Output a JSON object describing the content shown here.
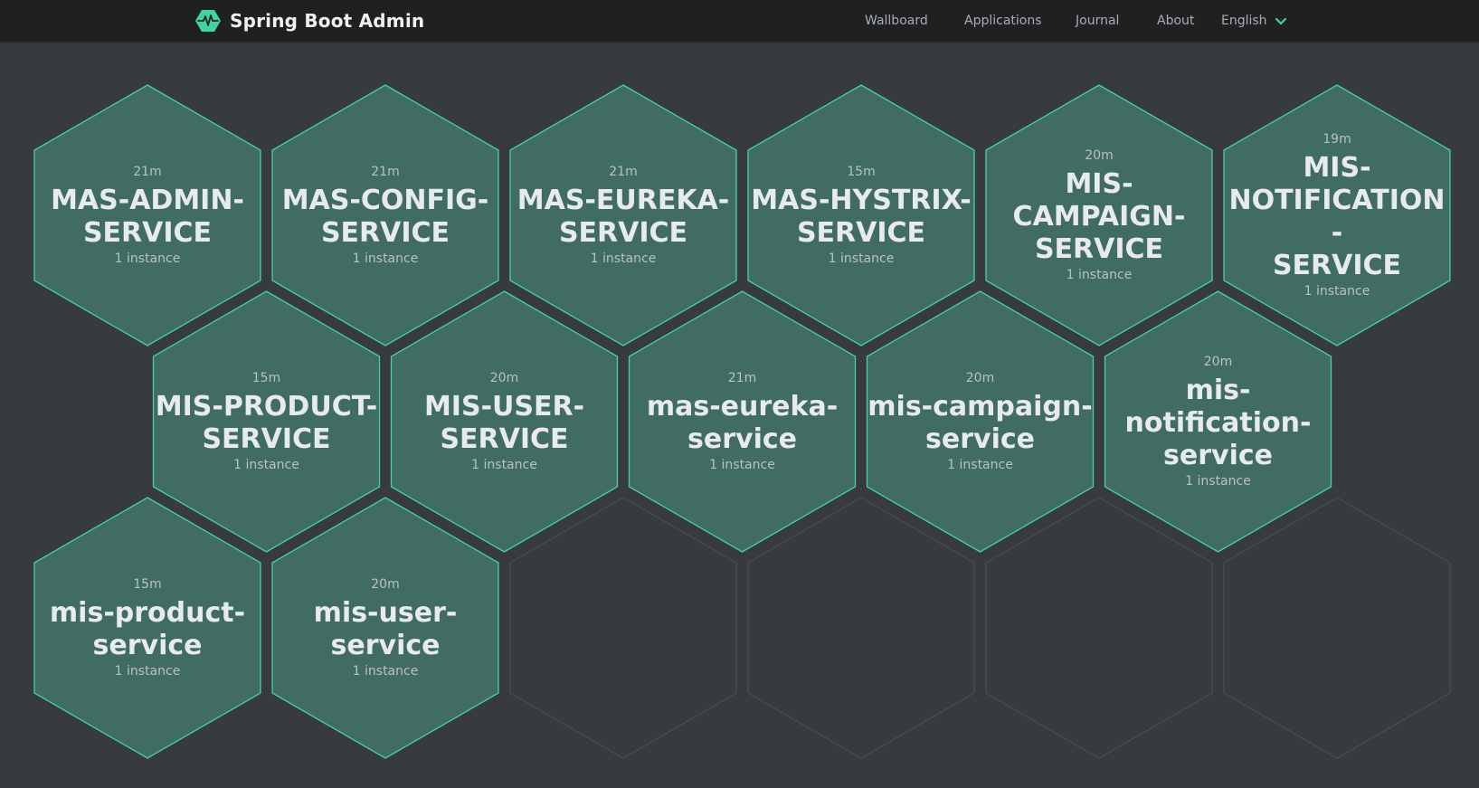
{
  "brand": {
    "title": "Spring Boot Admin",
    "icon": "pulse-logo-icon",
    "accent": "#42d3a5"
  },
  "nav": [
    {
      "label": "Wallboard"
    },
    {
      "label": "Applications"
    },
    {
      "label": "Journal"
    },
    {
      "label": "About"
    }
  ],
  "language": {
    "selected": "English",
    "icon": "chevron-down-icon"
  },
  "colors": {
    "background": "#373a3e",
    "navbar": "#1f2022",
    "hex_fill": "#416c62",
    "hex_border": "#42d3a5",
    "empty_border": "#4e5156"
  },
  "applications": [
    {
      "name": "MAS-ADMIN-SERVICE",
      "lines": [
        "MAS-ADMIN-",
        "SERVICE"
      ],
      "time": "21m",
      "instances": "1 instance"
    },
    {
      "name": "MAS-CONFIG-SERVICE",
      "lines": [
        "MAS-CONFIG-",
        "SERVICE"
      ],
      "time": "21m",
      "instances": "1 instance"
    },
    {
      "name": "MAS-EUREKA-SERVICE",
      "lines": [
        "MAS-EUREKA-",
        "SERVICE"
      ],
      "time": "21m",
      "instances": "1 instance"
    },
    {
      "name": "MAS-HYSTRIX-SERVICE",
      "lines": [
        "MAS-HYSTRIX-",
        "SERVICE"
      ],
      "time": "15m",
      "instances": "1 instance"
    },
    {
      "name": "MIS-CAMPAIGN-SERVICE",
      "lines": [
        "MIS-",
        "CAMPAIGN-",
        "SERVICE"
      ],
      "time": "20m",
      "instances": "1 instance"
    },
    {
      "name": "MIS-NOTIFICATION-SERVICE",
      "lines": [
        "MIS-",
        "NOTIFICATION-",
        "SERVICE"
      ],
      "time": "19m",
      "instances": "1 instance"
    },
    {
      "name": "MIS-PRODUCT-SERVICE",
      "lines": [
        "MIS-PRODUCT-",
        "SERVICE"
      ],
      "time": "15m",
      "instances": "1 instance"
    },
    {
      "name": "MIS-USER-SERVICE",
      "lines": [
        "MIS-USER-",
        "SERVICE"
      ],
      "time": "20m",
      "instances": "1 instance"
    },
    {
      "name": "mas-eureka-service",
      "lines": [
        "mas-eureka-",
        "service"
      ],
      "time": "21m",
      "instances": "1 instance"
    },
    {
      "name": "mis-campaign-service",
      "lines": [
        "mis-campaign-",
        "service"
      ],
      "time": "20m",
      "instances": "1 instance"
    },
    {
      "name": "mis-notification-service",
      "lines": [
        "mis-notification-",
        "service"
      ],
      "time": "20m",
      "instances": "1 instance"
    },
    {
      "name": "mis-product-service",
      "lines": [
        "mis-product-",
        "service"
      ],
      "time": "15m",
      "instances": "1 instance"
    },
    {
      "name": "mis-user-service",
      "lines": [
        "mis-user-",
        "service"
      ],
      "time": "20m",
      "instances": "1 instance"
    }
  ]
}
